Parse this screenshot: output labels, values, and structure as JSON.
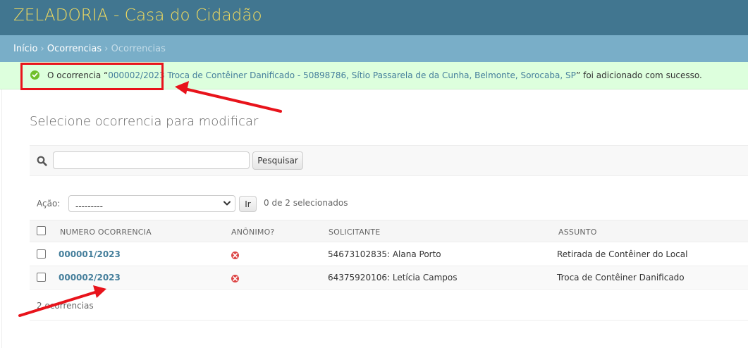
{
  "header": {
    "title": "ZELADORIA - Casa do Cidadão"
  },
  "breadcrumbs": {
    "home": "Início",
    "separator": "›",
    "app": "Ocorrencias",
    "current": "Ocorrencias"
  },
  "message": {
    "prefix": "O ocorrencia “",
    "object_link": "000002/2023  Troca de Contêiner Danificado - 50898786, Sítio Passarela de da Cunha, Belmonte, Sorocaba, SP",
    "suffix": "” foi adicionado com sucesso."
  },
  "content_title": "Selecione ocorrencia para modificar",
  "search": {
    "value": "",
    "placeholder": "",
    "button_label": "Pesquisar"
  },
  "actions": {
    "label": "Ação:",
    "selected_option": "---------",
    "go_label": "Ir",
    "selected_count": "0 de 2 selecionados"
  },
  "table": {
    "columns": [
      "NUMERO OCORRENCIA",
      "ANÔNIMO?",
      "SOLICITANTE",
      "ASSUNTO"
    ],
    "rows": [
      {
        "numero": "000001/2023",
        "anonimo": false,
        "solicitante": "54673102835: Alana Porto",
        "assunto": "Retirada de Contêiner do Local"
      },
      {
        "numero": "000002/2023",
        "anonimo": false,
        "solicitante": "64375920106: Letícia Campos",
        "assunto": "Troca de Contêiner Danificado"
      }
    ]
  },
  "paginator": {
    "text": "2 ocorrencias"
  },
  "colors": {
    "header_bg": "#417690",
    "title_color": "#f5dd5d",
    "breadcrumb_bg": "#79aec8",
    "success_bg": "#ddffdd",
    "link": "#447e9b",
    "annotation_red": "#e8131b"
  },
  "icons": {
    "success": "check-circle-icon",
    "search": "search-icon",
    "boolean_false": "x-circle-icon"
  }
}
